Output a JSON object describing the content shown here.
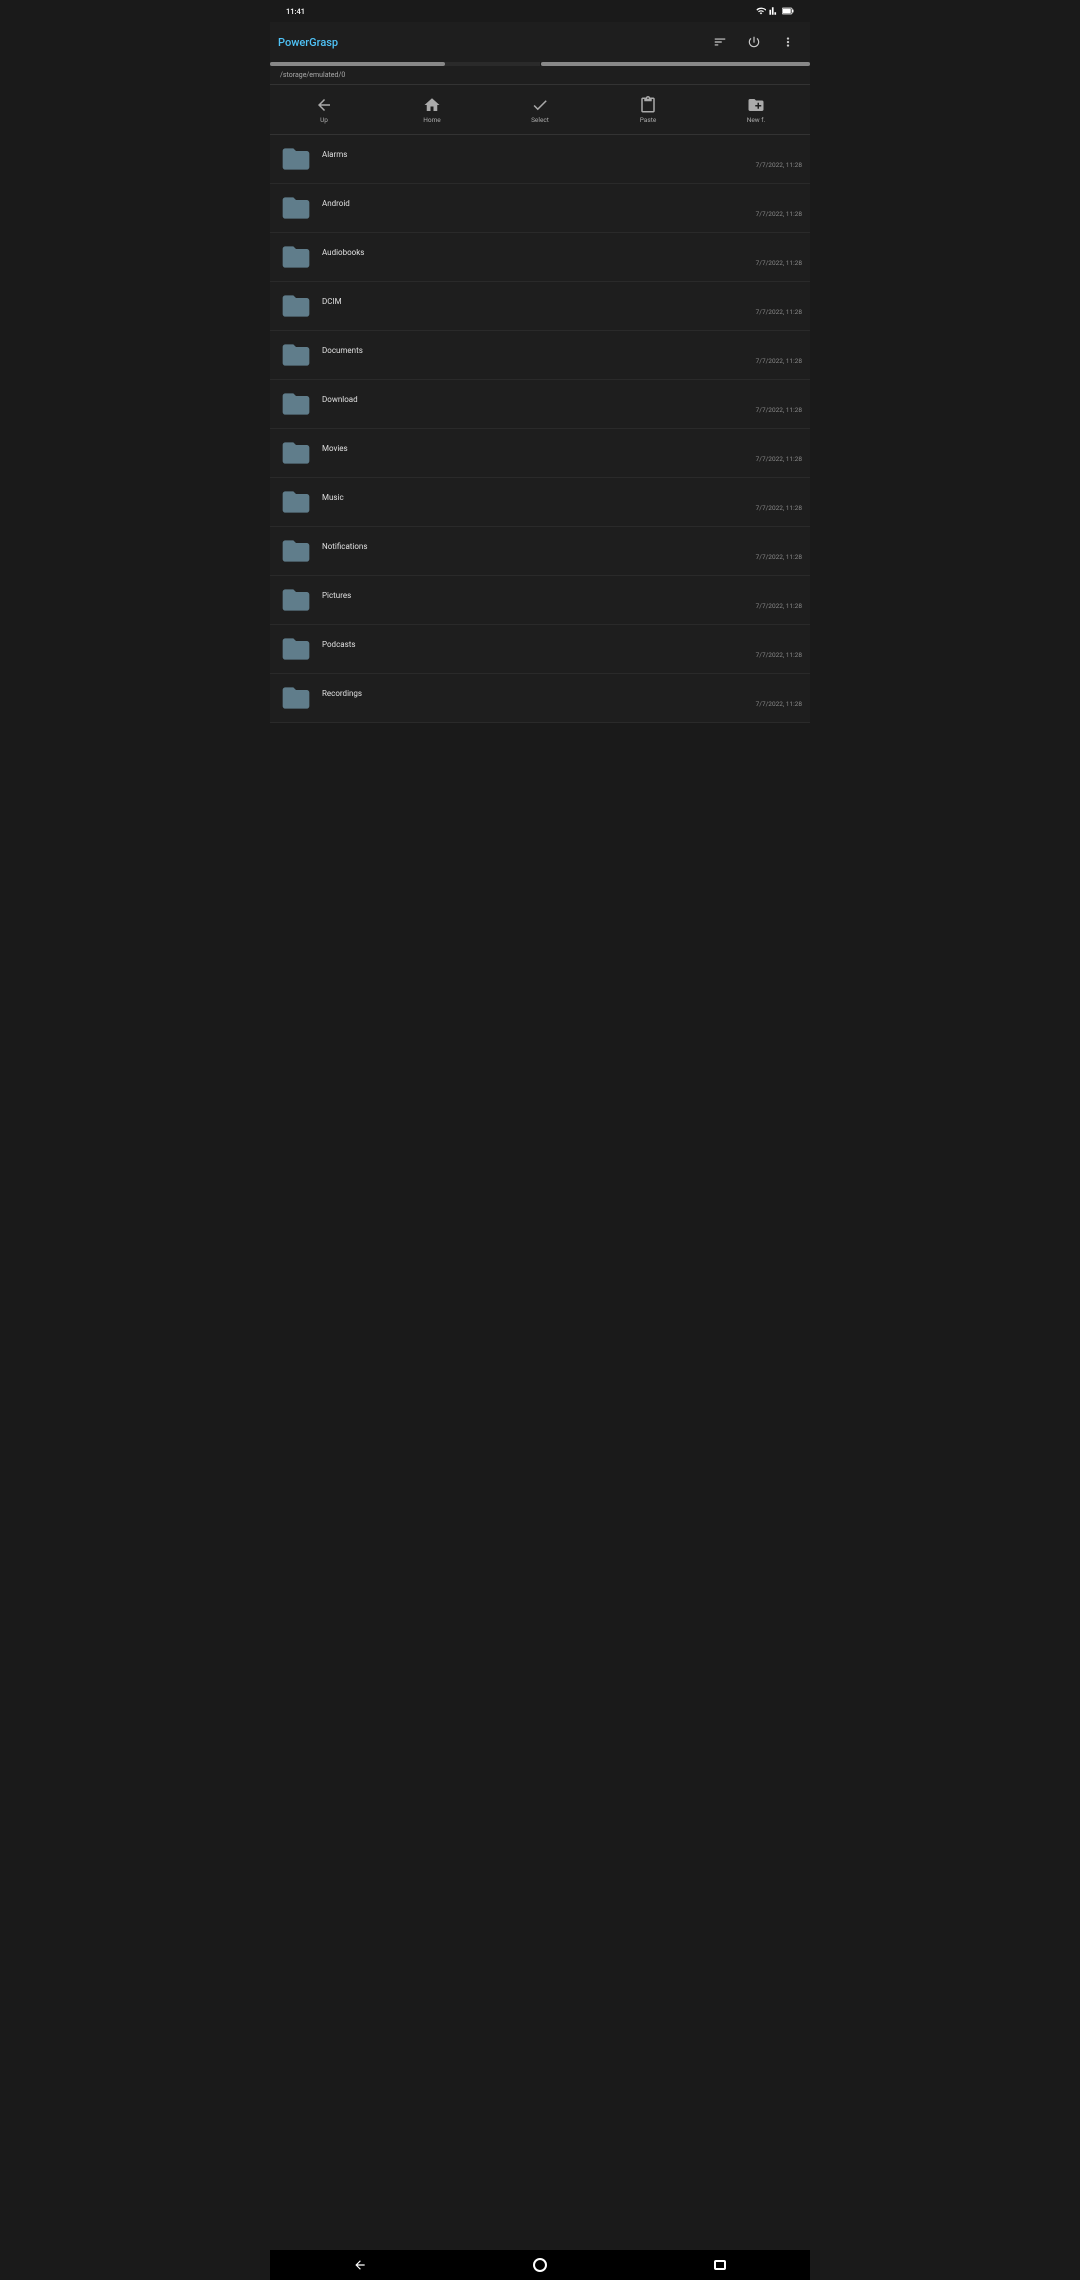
{
  "statusBar": {
    "time": "11:41",
    "icons": [
      "wifi",
      "signal",
      "battery"
    ]
  },
  "appBar": {
    "title": "PowerGrasp",
    "sortLabel": "sort-icon",
    "powerLabel": "power-icon",
    "moreLabel": "more-icon"
  },
  "breadcrumb": {
    "path": "/storage/emulated/0"
  },
  "navToolbar": {
    "buttons": [
      {
        "id": "up",
        "label": "Up"
      },
      {
        "id": "home",
        "label": "Home"
      },
      {
        "id": "select",
        "label": "Select"
      },
      {
        "id": "paste",
        "label": "Paste"
      },
      {
        "id": "new-folder",
        "label": "New f."
      }
    ]
  },
  "fileList": {
    "items": [
      {
        "name": "Alarms",
        "date": "7/7/2022, 11:28"
      },
      {
        "name": "Android",
        "date": "7/7/2022, 11:28"
      },
      {
        "name": "Audiobooks",
        "date": "7/7/2022, 11:28"
      },
      {
        "name": "DCIM",
        "date": "7/7/2022, 11:28"
      },
      {
        "name": "Documents",
        "date": "7/7/2022, 11:28"
      },
      {
        "name": "Download",
        "date": "7/7/2022, 11:28"
      },
      {
        "name": "Movies",
        "date": "7/7/2022, 11:28"
      },
      {
        "name": "Music",
        "date": "7/7/2022, 11:28"
      },
      {
        "name": "Notifications",
        "date": "7/7/2022, 11:28"
      },
      {
        "name": "Pictures",
        "date": "7/7/2022, 11:28"
      },
      {
        "name": "Podcasts",
        "date": "7/7/2022, 11:28"
      },
      {
        "name": "Recordings",
        "date": "7/7/2022, 11:28"
      }
    ]
  }
}
